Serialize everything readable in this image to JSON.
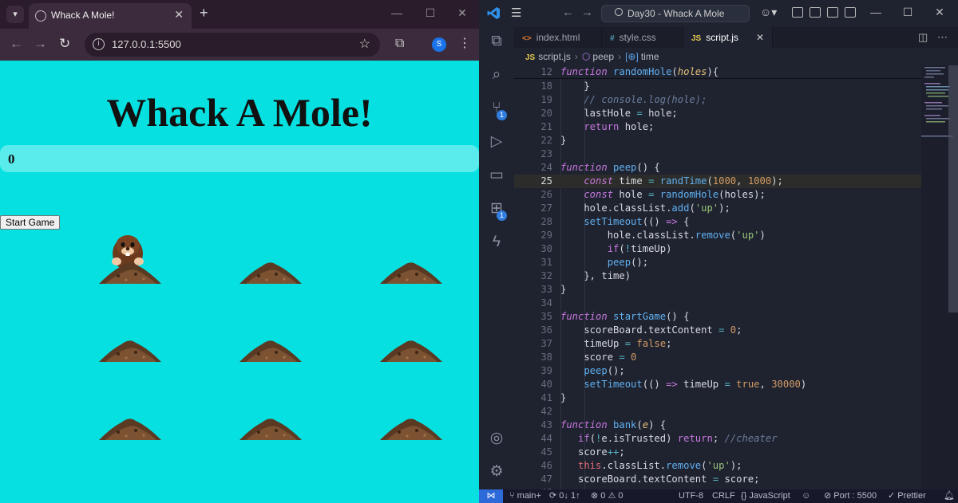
{
  "browser": {
    "tab_title": "Whack A Mole!",
    "tab_close": "✕",
    "new_tab": "+",
    "url": "127.0.0.1:5500",
    "profile_initial": "S",
    "window_controls": {
      "minimize": "—",
      "maximize": "☐",
      "close": "✕"
    }
  },
  "page": {
    "title": "Whack A Mole!",
    "score": "0",
    "start_button": "Start Game",
    "mole_visible_in_hole": 1
  },
  "vscode": {
    "command_center": "Day30 - Whack A Mole",
    "tabs": [
      {
        "icon": "<>",
        "label": "index.html",
        "icon_color": "#e37933"
      },
      {
        "icon": "#",
        "label": "style.css",
        "icon_color": "#519aba"
      },
      {
        "icon": "JS",
        "label": "script.js",
        "icon_color": "#e6c94f",
        "active": true
      }
    ],
    "active_tab_close": "✕",
    "breadcrumb": {
      "file_icon": "JS",
      "file": "script.js",
      "fn": "peep",
      "var": "time"
    },
    "activity_badges": {
      "scm": "1",
      "extensions": "1"
    },
    "code_lines": [
      {
        "n": "12",
        "sticky": true,
        "tokens": [
          [
            "k",
            "function "
          ],
          [
            "fn",
            "randomHole"
          ],
          [
            "p",
            "("
          ],
          [
            "pa",
            "holes"
          ],
          [
            "p",
            "){"
          ]
        ]
      },
      {
        "n": "18",
        "tokens": [
          [
            "p",
            "    }"
          ]
        ]
      },
      {
        "n": "19",
        "tokens": [
          [
            "c",
            "    // console.log(hole);"
          ]
        ]
      },
      {
        "n": "20",
        "tokens": [
          [
            "t",
            "    lastHole "
          ],
          [
            "b",
            "="
          ],
          [
            "t",
            " hole;"
          ]
        ]
      },
      {
        "n": "21",
        "tokens": [
          [
            "kn",
            "    return"
          ],
          [
            "t",
            " hole;"
          ]
        ]
      },
      {
        "n": "22",
        "tokens": [
          [
            "p",
            "}"
          ]
        ]
      },
      {
        "n": "23",
        "tokens": []
      },
      {
        "n": "24",
        "tokens": [
          [
            "k",
            "function "
          ],
          [
            "fn",
            "peep"
          ],
          [
            "p",
            "() {"
          ]
        ]
      },
      {
        "n": "25",
        "current": true,
        "tokens": [
          [
            "k",
            "    const "
          ],
          [
            "t",
            "time "
          ],
          [
            "b",
            "="
          ],
          [
            "fn",
            " randTime"
          ],
          [
            "p",
            "("
          ],
          [
            "n",
            "1000"
          ],
          [
            "p",
            ", "
          ],
          [
            "n",
            "1000"
          ],
          [
            "p",
            ");"
          ]
        ]
      },
      {
        "n": "26",
        "tokens": [
          [
            "k",
            "    const "
          ],
          [
            "t",
            "hole "
          ],
          [
            "b",
            "="
          ],
          [
            "fn",
            " randomHole"
          ],
          [
            "p",
            "("
          ],
          [
            "t",
            "holes"
          ],
          [
            "p",
            ");"
          ]
        ]
      },
      {
        "n": "27",
        "tokens": [
          [
            "t",
            "    hole.classList."
          ],
          [
            "fn",
            "add"
          ],
          [
            "p",
            "("
          ],
          [
            "s",
            "'up'"
          ],
          [
            "p",
            ");"
          ]
        ]
      },
      {
        "n": "28",
        "tokens": [
          [
            "fn",
            "    setTimeout"
          ],
          [
            "p",
            "(() "
          ],
          [
            "k",
            "=>"
          ],
          [
            "p",
            " {"
          ]
        ]
      },
      {
        "n": "29",
        "tokens": [
          [
            "t",
            "        hole.classList."
          ],
          [
            "fn",
            "remove"
          ],
          [
            "p",
            "("
          ],
          [
            "s",
            "'up'"
          ],
          [
            "p",
            ")"
          ]
        ]
      },
      {
        "n": "30",
        "tokens": [
          [
            "kn",
            "        if"
          ],
          [
            "p",
            "("
          ],
          [
            "b",
            "!"
          ],
          [
            "t",
            "timeUp"
          ],
          [
            "p",
            ")"
          ]
        ]
      },
      {
        "n": "31",
        "tokens": [
          [
            "fn",
            "        peep"
          ],
          [
            "p",
            "();"
          ]
        ]
      },
      {
        "n": "32",
        "tokens": [
          [
            "p",
            "    }, "
          ],
          [
            "t",
            "time"
          ],
          [
            "p",
            ")"
          ]
        ]
      },
      {
        "n": "33",
        "tokens": [
          [
            "p",
            "}"
          ]
        ]
      },
      {
        "n": "34",
        "tokens": []
      },
      {
        "n": "35",
        "tokens": [
          [
            "k",
            "function "
          ],
          [
            "fn",
            "startGame"
          ],
          [
            "p",
            "() {"
          ]
        ]
      },
      {
        "n": "36",
        "tokens": [
          [
            "t",
            "    scoreBoard.textContent "
          ],
          [
            "b",
            "="
          ],
          [
            "n",
            " 0"
          ],
          [
            "p",
            ";"
          ]
        ]
      },
      {
        "n": "37",
        "tokens": [
          [
            "t",
            "    timeUp "
          ],
          [
            "b",
            "="
          ],
          [
            "n",
            " false"
          ],
          [
            "p",
            ";"
          ]
        ]
      },
      {
        "n": "38",
        "tokens": [
          [
            "t",
            "    score "
          ],
          [
            "b",
            "="
          ],
          [
            "n",
            " 0"
          ]
        ]
      },
      {
        "n": "39",
        "tokens": [
          [
            "fn",
            "    peep"
          ],
          [
            "p",
            "();"
          ]
        ]
      },
      {
        "n": "40",
        "tokens": [
          [
            "fn",
            "    setTimeout"
          ],
          [
            "p",
            "(() "
          ],
          [
            "k",
            "=>"
          ],
          [
            "t",
            " timeUp "
          ],
          [
            "b",
            "="
          ],
          [
            "n",
            " true"
          ],
          [
            "p",
            ", "
          ],
          [
            "n",
            "30000"
          ],
          [
            "p",
            ")"
          ]
        ]
      },
      {
        "n": "41",
        "tokens": [
          [
            "p",
            "}"
          ]
        ]
      },
      {
        "n": "42",
        "tokens": []
      },
      {
        "n": "43",
        "tokens": [
          [
            "k",
            "function "
          ],
          [
            "fn",
            "bank"
          ],
          [
            "p",
            "("
          ],
          [
            "pa",
            "e"
          ],
          [
            "p",
            ") {"
          ]
        ]
      },
      {
        "n": "44",
        "tokens": [
          [
            "kn",
            "   if"
          ],
          [
            "p",
            "("
          ],
          [
            "b",
            "!"
          ],
          [
            "t",
            "e.isTrusted"
          ],
          [
            "p",
            ") "
          ],
          [
            "kn",
            "return"
          ],
          [
            "p",
            "; "
          ],
          [
            "c",
            "//cheater"
          ]
        ]
      },
      {
        "n": "45",
        "tokens": [
          [
            "t",
            "   score"
          ],
          [
            "b",
            "++"
          ],
          [
            "p",
            ";"
          ]
        ]
      },
      {
        "n": "46",
        "tokens": [
          [
            "ob",
            "   this"
          ],
          [
            "t",
            ".classList."
          ],
          [
            "fn",
            "remove"
          ],
          [
            "p",
            "("
          ],
          [
            "s",
            "'up'"
          ],
          [
            "p",
            ");"
          ]
        ]
      },
      {
        "n": "47",
        "tokens": [
          [
            "t",
            "   scoreBoard.textContent "
          ],
          [
            "b",
            "="
          ],
          [
            "t",
            " score;"
          ]
        ]
      },
      {
        "n": "48",
        "tokens": []
      }
    ],
    "status": {
      "branch": "main+",
      "sync": "0↓ 1↑",
      "errors": "0",
      "warnings": "0",
      "encoding": "UTF-8",
      "eol": "CRLF",
      "language": "JavaScript",
      "port": "Port : 5500",
      "prettier": "Prettier"
    }
  },
  "colors": {
    "page_bg": "#07e0e0",
    "score_bar": "#5aecec",
    "editor_bg": "#1f2330"
  }
}
